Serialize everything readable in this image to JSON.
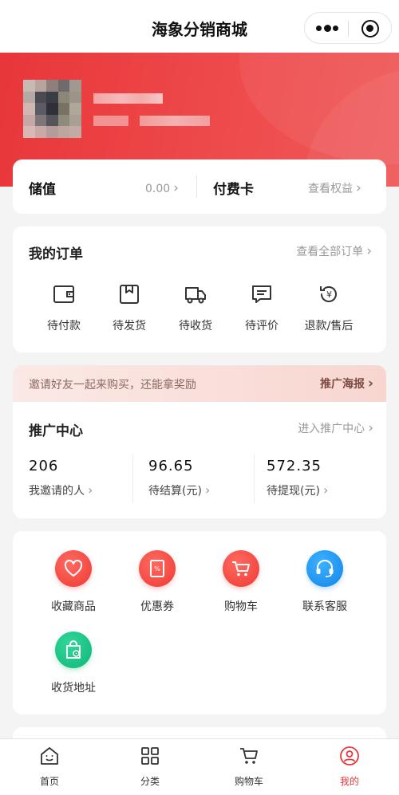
{
  "navbar": {
    "title": "海象分销商城"
  },
  "colors": {
    "brand": "#e8363a",
    "muted": "#999999"
  },
  "balance": {
    "stored_label": "储值",
    "stored_value": "0.00",
    "card_label": "付费卡",
    "card_link": "查看权益"
  },
  "orders": {
    "title": "我的订单",
    "view_all": "查看全部订单",
    "items": [
      {
        "label": "待付款",
        "icon": "wallet-icon"
      },
      {
        "label": "待发货",
        "icon": "package-icon"
      },
      {
        "label": "待收货",
        "icon": "truck-icon"
      },
      {
        "label": "待评价",
        "icon": "review-icon"
      },
      {
        "label": "退款/售后",
        "icon": "refund-icon"
      }
    ]
  },
  "invite": {
    "text": "邀请好友一起来购买，还能拿奖励",
    "poster": "推广海报"
  },
  "promotion": {
    "title": "推广中心",
    "enter": "进入推广中心",
    "stats": [
      {
        "value": "206",
        "label": "我邀请的人"
      },
      {
        "value": "96.65",
        "label": "待结算(元)"
      },
      {
        "value": "572.35",
        "label": "待提现(元)"
      }
    ]
  },
  "tools": [
    {
      "label": "收藏商品",
      "icon": "heart-icon"
    },
    {
      "label": "优惠券",
      "icon": "coupon-icon"
    },
    {
      "label": "购物车",
      "icon": "cart-icon"
    },
    {
      "label": "联系客服",
      "icon": "headset-icon"
    },
    {
      "label": "收货地址",
      "icon": "address-bag-icon"
    }
  ],
  "tabbar": [
    {
      "label": "首页",
      "icon": "home-icon"
    },
    {
      "label": "分类",
      "icon": "category-icon"
    },
    {
      "label": "购物车",
      "icon": "cart-icon"
    },
    {
      "label": "我的",
      "icon": "profile-icon",
      "active": true
    }
  ]
}
